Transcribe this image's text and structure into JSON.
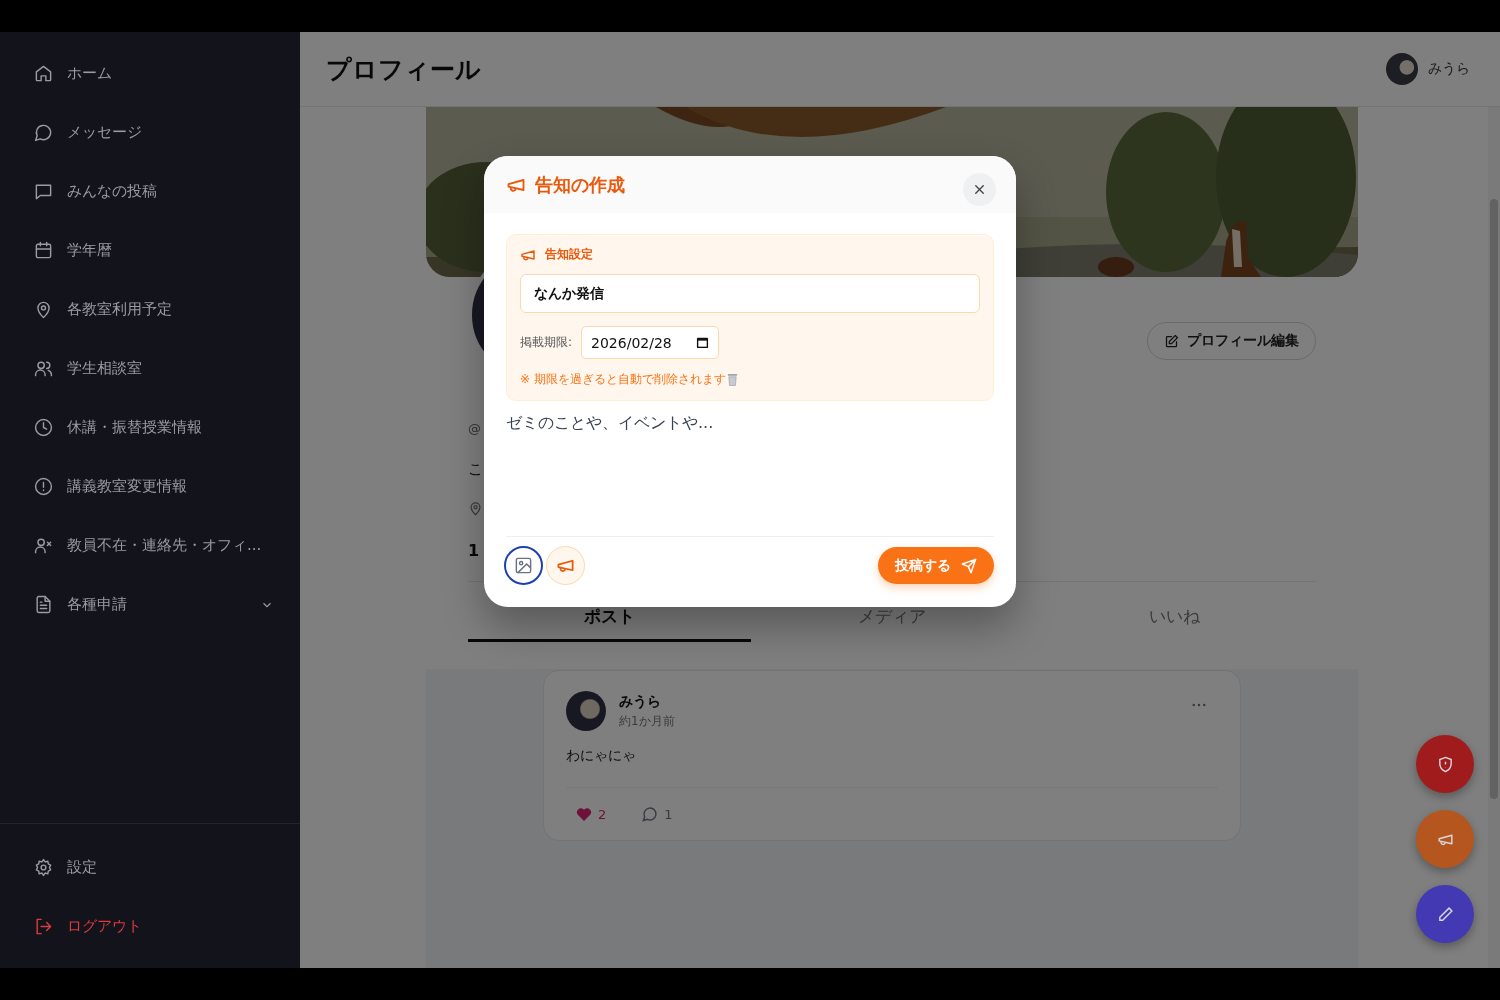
{
  "header": {
    "title": "プロフィール",
    "user": "みうら"
  },
  "sidebar": {
    "items": [
      {
        "label": "ホーム"
      },
      {
        "label": "メッセージ"
      },
      {
        "label": "みんなの投稿"
      },
      {
        "label": "学年暦"
      },
      {
        "label": "各教室利用予定"
      },
      {
        "label": "学生相談室"
      },
      {
        "label": "休講・振替授業情報"
      },
      {
        "label": "講義教室変更情報"
      },
      {
        "label": "教員不在・連絡先・オフィ..."
      },
      {
        "label": "各種申請",
        "expanded": false
      }
    ],
    "footer": [
      {
        "label": "設定",
        "kind": "normal"
      },
      {
        "label": "ログアウト",
        "kind": "danger"
      }
    ]
  },
  "profile": {
    "handle": "@",
    "bio": "こ",
    "stat": "1",
    "edit_button": "プロフィール編集"
  },
  "tabs": [
    {
      "label": "ポスト",
      "selected": true
    },
    {
      "label": "メディア",
      "selected": false
    },
    {
      "label": "いいね",
      "selected": false
    }
  ],
  "posts": [
    {
      "author": "みうら",
      "time": "約1か月前",
      "text": "わにゃにゃ",
      "likes": "2",
      "liked": true,
      "comments": "1"
    }
  ],
  "modal": {
    "title": "告知の作成",
    "announce_on": true,
    "section_label": "告知設定",
    "title_value": "なんか発信",
    "expiry_label": "掲載期限:",
    "expiry_value": "2026/02/28",
    "note": "※ 期限を過ぎると自動で削除されます",
    "placeholder": "ゼミのことや、イベントや...",
    "submit": "投稿する"
  }
}
